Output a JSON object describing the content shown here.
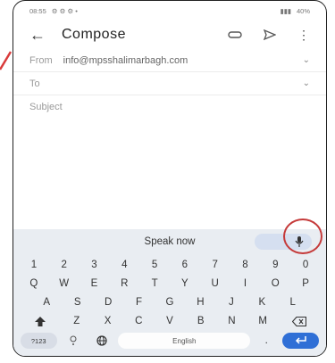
{
  "status": {
    "time": "08:55",
    "battery": "40%"
  },
  "appbar": {
    "title": "Compose",
    "back_icon": "back-arrow-icon",
    "attach_icon": "attach-icon",
    "send_icon": "send-icon",
    "more_icon": "more-vert-icon"
  },
  "from": {
    "label": "From",
    "value": "info@mpsshalimarbagh.com"
  },
  "to": {
    "label": "To"
  },
  "subject": {
    "placeholder": "Subject"
  },
  "keyboard": {
    "speak_label": "Speak now",
    "row_numbers": [
      "1",
      "2",
      "3",
      "4",
      "5",
      "6",
      "7",
      "8",
      "9",
      "0"
    ],
    "row1": [
      "Q",
      "W",
      "E",
      "R",
      "T",
      "Y",
      "U",
      "I",
      "O",
      "P"
    ],
    "row2": [
      "A",
      "S",
      "D",
      "F",
      "G",
      "H",
      "J",
      "K",
      "L"
    ],
    "row3": [
      "Z",
      "X",
      "C",
      "V",
      "B",
      "N",
      "M"
    ],
    "symbols_key": "?123",
    "space_label": "English",
    "period": ".",
    "colors": {
      "enter": "#2f6fd6",
      "highlight_circle": "#c53a3a",
      "arrow": "#d93a3a"
    }
  }
}
